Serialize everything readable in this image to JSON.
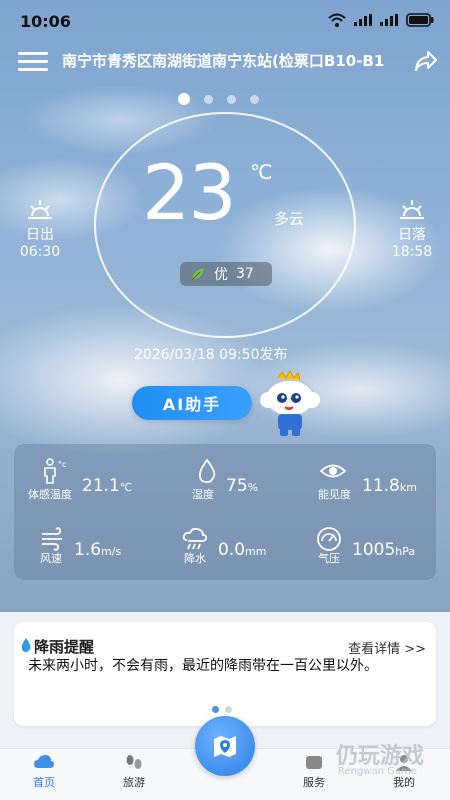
{
  "status_bar": {
    "time": "10:06"
  },
  "header": {
    "location": "南宁市青秀区南湖街道南宁东站(检票口B10-B1",
    "icons": {
      "menu": "menu-icon",
      "share": "share-icon"
    }
  },
  "carousel": {
    "pages": 4,
    "active_index": 0
  },
  "weather": {
    "temperature": "23",
    "unit": "℃",
    "condition": "多云",
    "aqi_label": "优",
    "aqi_value": "37",
    "sunrise_label": "日出",
    "sunrise_time": "06:30",
    "sunset_label": "日落",
    "sunset_time": "18:58",
    "publish_time": "2026/03/18 09:50发布"
  },
  "ai_button": {
    "label": "AI助手"
  },
  "details": {
    "feels_like": {
      "label": "体感温度",
      "value": "21.1",
      "unit": "℃"
    },
    "humidity": {
      "label": "湿度",
      "value": "75",
      "unit": "%"
    },
    "visibility": {
      "label": "能见度",
      "value": "11.8",
      "unit": "km"
    },
    "wind": {
      "label": "风速",
      "value": "1.6",
      "unit": "m/s"
    },
    "precip": {
      "label": "降水",
      "value": "0.0",
      "unit": "mm"
    },
    "pressure": {
      "label": "气压",
      "value": "1005",
      "unit": "hPa"
    }
  },
  "reminder": {
    "title": "降雨提醒",
    "more": "查看详情 >>",
    "text": "未来两小时，不会有雨，最近的降雨带在一百公里以外。",
    "pages": 2,
    "active_index": 0
  },
  "nav": {
    "home": "首页",
    "travel": "旅游",
    "service": "服务",
    "mine": "我的"
  },
  "watermark": {
    "main": "仍玩游戏",
    "sub": "Rengwan Game"
  },
  "colors": {
    "accent": "#2a7be6",
    "ai_button": "#1f8ff2"
  }
}
